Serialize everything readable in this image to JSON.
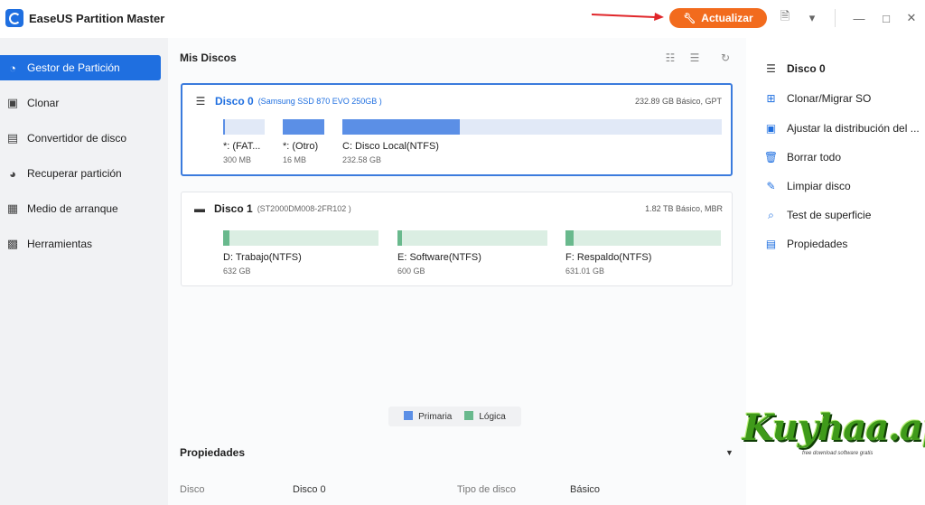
{
  "app": {
    "title": "EaseUS Partition Master",
    "update_label": "Actualizar"
  },
  "sidebar": {
    "items": [
      {
        "label": "Gestor de Partición",
        "icon": "pie-chart-icon",
        "active": true
      },
      {
        "label": "Clonar",
        "icon": "clone-icon"
      },
      {
        "label": "Convertidor de disco",
        "icon": "disk-convert-icon"
      },
      {
        "label": "Recuperar partición",
        "icon": "recover-icon"
      },
      {
        "label": "Medio de arranque",
        "icon": "boot-media-icon"
      },
      {
        "label": "Herramientas",
        "icon": "toolbox-icon"
      }
    ]
  },
  "main": {
    "title": "Mis Discos",
    "disks": [
      {
        "name": "Disco 0",
        "model": "(Samsung SSD 870 EVO 250GB )",
        "info": "232.89 GB Básico, GPT",
        "partitions": [
          {
            "name": "*: (FAT...",
            "size": "300 MB",
            "used": 0.05,
            "type": "primaria"
          },
          {
            "name": "*: (Otro)",
            "size": "16 MB",
            "used": 1.0,
            "type": "primaria"
          },
          {
            "name": "C: Disco Local(NTFS)",
            "size": "232.58 GB",
            "used": 0.31,
            "type": "primaria"
          }
        ]
      },
      {
        "name": "Disco 1",
        "model": "(ST2000DM008-2FR102 )",
        "info": "1.82 TB Básico, MBR",
        "partitions": [
          {
            "name": "D: Trabajo(NTFS)",
            "size": "632 GB",
            "used": 0.04,
            "type": "logica"
          },
          {
            "name": "E: Software(NTFS)",
            "size": "600 GB",
            "used": 0.03,
            "type": "logica"
          },
          {
            "name": "F: Respaldo(NTFS)",
            "size": "631.01 GB",
            "used": 0.05,
            "type": "logica"
          }
        ]
      }
    ],
    "legend": {
      "primary": "Primaria",
      "logical": "Lógica"
    },
    "properties": {
      "title": "Propiedades",
      "disk_key": "Disco",
      "disk_value": "Disco 0",
      "type_key": "Tipo de disco",
      "type_value": "Básico"
    }
  },
  "right": {
    "header": "Disco 0",
    "actions": [
      {
        "label": "Clonar/Migrar SO",
        "icon": "windows-icon"
      },
      {
        "label": "Ajustar la distribución del ...",
        "icon": "adjust-layout-icon"
      },
      {
        "label": "Borrar todo",
        "icon": "trash-icon"
      },
      {
        "label": "Limpiar disco",
        "icon": "eraser-icon"
      },
      {
        "label": "Test de superficie",
        "icon": "surface-test-icon"
      },
      {
        "label": "Propiedades",
        "icon": "properties-icon"
      }
    ]
  },
  "watermark": {
    "text": "Kuyhaa.app",
    "sub": "free download software gratis"
  },
  "colors": {
    "accent": "#1f6fe0",
    "update": "#f26b1d",
    "primary": "#5b8fe6",
    "logical": "#69b98d"
  }
}
